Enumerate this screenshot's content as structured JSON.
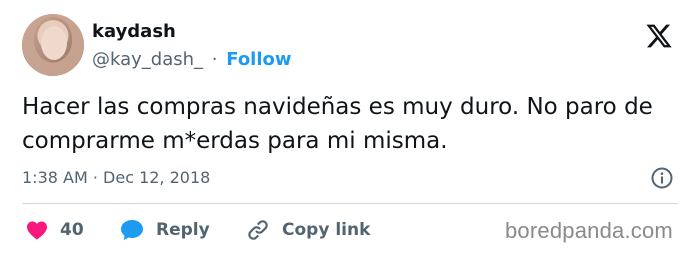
{
  "author": {
    "display_name": "kaydash",
    "handle": "@kay_dash_",
    "separator": "·",
    "follow_label": "Follow"
  },
  "tweet": {
    "text": "Hacer las compras navideñas es muy duro. No paro de comprarme m*erdas para mi misma.",
    "timestamp": "1:38 AM · Dec 12, 2018"
  },
  "actions": {
    "like_count": "40",
    "reply_label": "Reply",
    "copy_link_label": "Copy link"
  },
  "watermark": "boredpanda.com",
  "colors": {
    "accent": "#1d9bf0",
    "like": "#f91880",
    "text": "#0f1419",
    "secondary": "#536471"
  },
  "icons": {
    "platform": "x-logo-icon",
    "info": "info-icon",
    "like": "heart-icon",
    "reply": "speech-bubble-icon",
    "copy": "link-icon"
  }
}
